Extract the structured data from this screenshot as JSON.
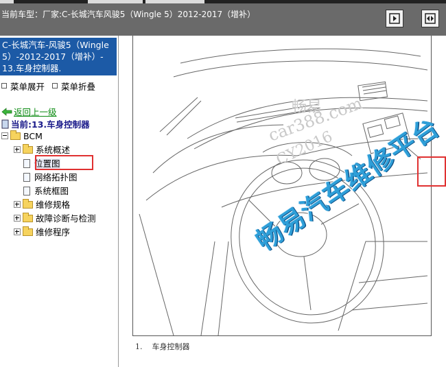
{
  "header": {
    "vehicle_prefix": "当前车型：",
    "vehicle_value": "厂家:C-长城汽车风骏5（Wingle 5）2012-2017（增补）",
    "next_icon": "next-page-icon",
    "fit_icon": "fit-width-icon"
  },
  "sidebar": {
    "title": "C-长城汽车-风骏5（Wingle 5）-2012-2017（增补）- 13.车身控制器.",
    "expand_all": "菜单展开",
    "collapse_all": "菜单折叠",
    "back": "返回上一级",
    "current": "当前:13.车身控制器",
    "tree": {
      "root": "BCM",
      "overview": "系统概述",
      "location": "位置图",
      "topology": "网络拓扑图",
      "block": "系统框图",
      "specs": "维修规格",
      "diag": "故障诊断与检测",
      "procedure": "维修程序"
    }
  },
  "content": {
    "caption_num": "1.",
    "caption_text": "车身控制器",
    "watermark_1": "畅易",
    "watermark_2": "car388.com",
    "watermark_3": "CY2016",
    "watermark_big": "畅易汽车维修平台"
  },
  "colors": {
    "title_bg": "#1c5aa6",
    "header_bg": "#6a6a6a",
    "highlight": "#e03030",
    "watermark": "#2f9fd8"
  }
}
